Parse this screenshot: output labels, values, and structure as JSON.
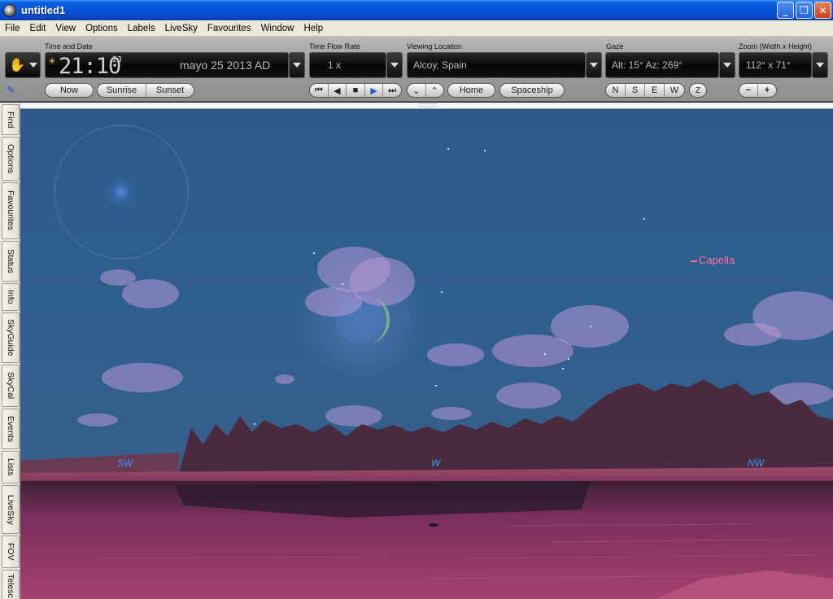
{
  "window": {
    "title": "untitled1",
    "buttons": {
      "minimize": "_",
      "maximize": "❐",
      "close": "✕"
    }
  },
  "menu": [
    "File",
    "Edit",
    "View",
    "Options",
    "Labels",
    "LiveSky",
    "Favourites",
    "Window",
    "Help"
  ],
  "toolbar": {
    "time_and_date": {
      "label": "Time and Date",
      "time": "21:10",
      "seconds": "23",
      "date": "mayo 25   2013 AD",
      "buttons": {
        "now": "Now",
        "sunrise": "Sunrise",
        "sunset": "Sunset"
      }
    },
    "time_flow": {
      "label": "Time Flow Rate",
      "value": "1 x"
    },
    "location": {
      "label": "Viewing Location",
      "value": "Alcoy, Spain",
      "buttons": {
        "home": "Home",
        "spaceship": "Spaceship"
      }
    },
    "gaze": {
      "label": "Gaze",
      "value": "Alt: 15° Az: 269°",
      "directions": [
        "N",
        "S",
        "E",
        "W"
      ],
      "zenith": "Z"
    },
    "zoom": {
      "label": "Zoom (Width x Height)",
      "value": "112° x 71°",
      "minus": "−",
      "plus": "+"
    }
  },
  "sidetabs": [
    "Find",
    "Options",
    "Favourites",
    "Status",
    "Info",
    "SkyGuide",
    "SkyCal",
    "Events",
    "Lists",
    "LiveSky",
    "FOV",
    "Telesc"
  ],
  "sky": {
    "star_label": "Capella",
    "label_color": "#ff6fa8",
    "directions": [
      "SW",
      "W",
      "NW"
    ]
  }
}
